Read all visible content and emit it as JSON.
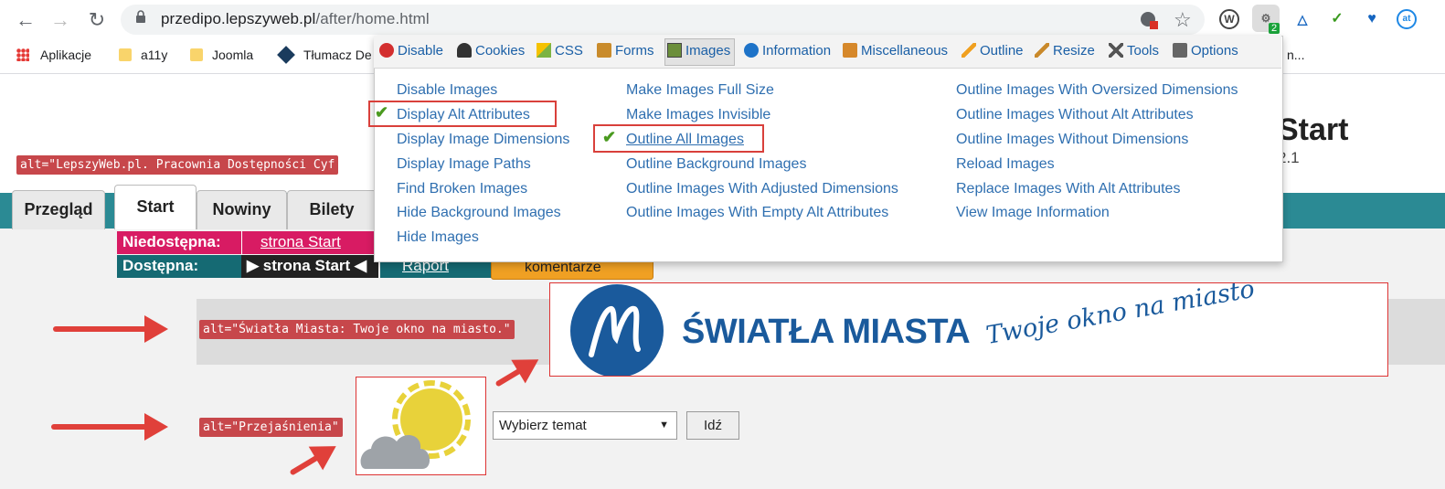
{
  "browser": {
    "url_host": "przedipo.lepszyweb.pl",
    "url_path": "/after/home.html",
    "ext_badge": "2",
    "bookmarks": [
      "Aplikacje",
      "a11y",
      "Joomla",
      "Tłumacz De"
    ],
    "bookmark_tail": "n..."
  },
  "webdev": {
    "tabs": [
      "Disable",
      "Cookies",
      "CSS",
      "Forms",
      "Images",
      "Information",
      "Miscellaneous",
      "Outline",
      "Resize",
      "Tools",
      "Options"
    ],
    "col1": [
      "Disable Images",
      "Display Alt Attributes",
      "Display Image Dimensions",
      "Display Image Paths",
      "Find Broken Images",
      "Hide Background Images",
      "Hide Images"
    ],
    "col2": [
      "Make Images Full Size",
      "Make Images Invisible",
      "Outline All Images",
      "Outline Background Images",
      "Outline Images With Adjusted Dimensions",
      "Outline Images With Empty Alt Attributes"
    ],
    "col3": [
      "Outline Images With Oversized Dimensions",
      "Outline Images Without Alt Attributes",
      "Outline Images Without Dimensions",
      "Reload Images",
      "Replace Images With Alt Attributes",
      "View Image Information"
    ]
  },
  "page": {
    "hero_title": "Start",
    "hero_sub": "2.1",
    "alt_logo": "alt=\"LepszyWeb.pl. Pracownia Dostępności Cyf",
    "alt_banner": "alt=\"Światła Miasta: Twoje okno na miasto.\"",
    "alt_weather": "alt=\"Przejaśnienia\"",
    "tabs": [
      "Przegląd",
      "Start",
      "Nowiny",
      "Bilety"
    ],
    "status": {
      "unavailable_label": "Niedostępna:",
      "unavailable_link": "strona Start",
      "available_label": "Dostępna:",
      "available_value": "strona Start",
      "report_link": "Raport",
      "comments": "komentarze"
    },
    "banner_title": "ŚWIATŁA MIASTA",
    "banner_tagline": "Twoje okno na miasto",
    "select_value": "Wybierz temat",
    "go_button": "Idź"
  },
  "colors": {
    "teal": "#2b8a94",
    "alt_tag": "#c7474b",
    "highlight": "#d9403b",
    "brand_blue": "#1a5a9c"
  }
}
